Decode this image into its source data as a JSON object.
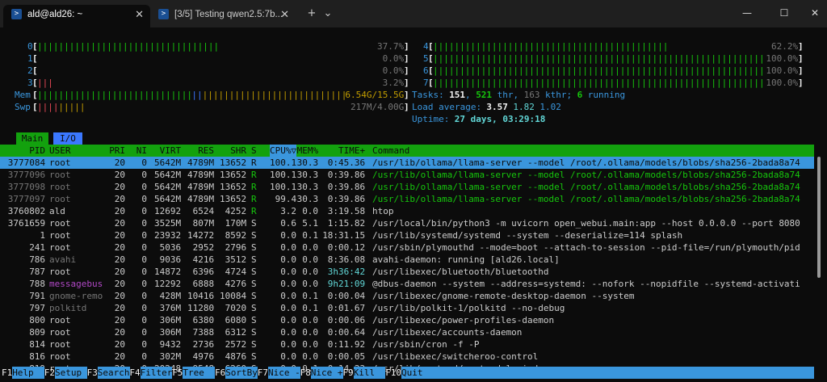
{
  "window": {
    "tabs": [
      {
        "title": "ald@ald26: ~",
        "icon": "terminal-icon"
      },
      {
        "title": "[3/5] Testing qwen2.5:7b...",
        "icon": "terminal-icon"
      }
    ],
    "controls": {
      "new_tab": "+",
      "dropdown": "⌄",
      "minimize": "—",
      "maximize": "☐",
      "close": "✕"
    }
  },
  "meters": {
    "cpus_left": [
      {
        "id": "0",
        "bar": "||||||||||||||||||||||||||||||||||",
        "pct": "37.7%"
      },
      {
        "id": "1",
        "bar": "",
        "pct": "0.0%"
      },
      {
        "id": "2",
        "bar": "",
        "pct": "0.0%"
      },
      {
        "id": "3",
        "bar": "|||",
        "pct": "3.2%"
      }
    ],
    "cpus_right": [
      {
        "id": "4",
        "bar": "|||||||||||||||||||||||||||||||||||||||||||||||||||||||||||||||||||||||||||",
        "pct": "62.2%"
      },
      {
        "id": "5",
        "bar": "||||||||||||||||||||||||||||||||||||||||||||||||||||||||||||||||||||||||||||||||||||||||||||||||||||||||||||||||||||||||||||",
        "pct": "100.0%"
      },
      {
        "id": "6",
        "bar": "||||||||||||||||||||||||||||||||||||||||||||||||||||||||||||||||||||||||||||||||||||||||||||||||||||||||||||||||||||||||||||",
        "pct": "100.0%"
      },
      {
        "id": "7",
        "bar": "||||||||||||||||||||||||||||||||||||||||||||||||||||||||||||||||||||||||||||||||||||||||||||||||||||||||||||||||||||||||||||",
        "pct": "100.0%"
      }
    ],
    "mem": {
      "label": "Mem",
      "used_bar": "|||||||||||||||||||||||||||||",
      "buffer_bar": "||",
      "cache_bar": "||||||||||||||||||||||||||||||||||||||||||||||||",
      "value": "6.54G/15.5G"
    },
    "swp": {
      "label": "Swp",
      "used_bar": "||||",
      "cache_bar": "|||||",
      "value": "217M/4.00G"
    },
    "tasks": {
      "label": "Tasks: ",
      "count": "151",
      "threads": "521",
      "thr_label": " thr, ",
      "kthr": "163",
      "kthr_label": " kthr; ",
      "running": "6",
      "running_label": " running"
    },
    "load": {
      "label": "Load average: ",
      "l1": "3.57",
      "l5": "1.82",
      "l15": "1.02"
    },
    "uptime": {
      "label": "Uptime: ",
      "value": "27 days, 03:29:18"
    }
  },
  "tabs": {
    "main": "Main",
    "io": "I/O"
  },
  "columns": {
    "pid": "PID",
    "user": "USER",
    "pri": "PRI",
    "ni": "NI",
    "virt": "VIRT",
    "res": "RES",
    "shr": "SHR",
    "s": "S",
    "cpu": "CPU%▽",
    "mem": "MEM%",
    "time": "TIME+",
    "cmd": "Command"
  },
  "processes": [
    {
      "pid": "3777084",
      "user": "root",
      "pri": "20",
      "ni": "0",
      "virt": "5642M",
      "res": "4789M",
      "shr": "13652",
      "s": "R",
      "cpu": "100.1",
      "mem": "30.3",
      "time": "0:45.36",
      "cmd": "/usr/lib/ollama/llama-server --model /root/.ollama/models/blobs/sha256-2bada8a74"
    },
    {
      "pid": "3777096",
      "user": "root",
      "pri": "20",
      "ni": "0",
      "virt": "5642M",
      "res": "4789M",
      "shr": "13652",
      "s": "R",
      "cpu": "100.1",
      "mem": "30.3",
      "time": "0:39.86",
      "cmd": "/usr/lib/ollama/llama-server --model /root/.ollama/models/blobs/sha256-2bada8a74"
    },
    {
      "pid": "3777098",
      "user": "root",
      "pri": "20",
      "ni": "0",
      "virt": "5642M",
      "res": "4789M",
      "shr": "13652",
      "s": "R",
      "cpu": "100.1",
      "mem": "30.3",
      "time": "0:39.86",
      "cmd": "/usr/lib/ollama/llama-server --model /root/.ollama/models/blobs/sha256-2bada8a74"
    },
    {
      "pid": "3777097",
      "user": "root",
      "pri": "20",
      "ni": "0",
      "virt": "5642M",
      "res": "4789M",
      "shr": "13652",
      "s": "R",
      "cpu": "99.4",
      "mem": "30.3",
      "time": "0:39.86",
      "cmd": "/usr/lib/ollama/llama-server --model /root/.ollama/models/blobs/sha256-2bada8a74"
    },
    {
      "pid": "3760802",
      "user": "ald",
      "pri": "20",
      "ni": "0",
      "virt": "12692",
      "res": "6524",
      "shr": "4252",
      "s": "R",
      "cpu": "3.2",
      "mem": "0.0",
      "time": "3:19.58",
      "cmd": "htop"
    },
    {
      "pid": "3761659",
      "user": "root",
      "pri": "20",
      "ni": "0",
      "virt": "3525M",
      "res": "807M",
      "shr": "170M",
      "s": "S",
      "cpu": "0.6",
      "mem": "5.1",
      "time": "1:15.82",
      "cmd": "/usr/local/bin/python3 -m uvicorn open_webui.main:app --host 0.0.0.0 --port 8080"
    },
    {
      "pid": "1",
      "user": "root",
      "pri": "20",
      "ni": "0",
      "virt": "23932",
      "res": "14272",
      "shr": "8592",
      "s": "S",
      "cpu": "0.0",
      "mem": "0.1",
      "time": "18:31.15",
      "cmd": "/usr/lib/systemd/systemd --system --deserialize=114 splash"
    },
    {
      "pid": "241",
      "user": "root",
      "pri": "20",
      "ni": "0",
      "virt": "5036",
      "res": "2952",
      "shr": "2796",
      "s": "S",
      "cpu": "0.0",
      "mem": "0.0",
      "time": "0:00.12",
      "cmd": "/usr/sbin/plymouthd --mode=boot --attach-to-session --pid-file=/run/plymouth/pid"
    },
    {
      "pid": "786",
      "user": "avahi",
      "pri": "20",
      "ni": "0",
      "virt": "9036",
      "res": "4216",
      "shr": "3512",
      "s": "S",
      "cpu": "0.0",
      "mem": "0.0",
      "time": "8:36.08",
      "cmd": "avahi-daemon: running [ald26.local]"
    },
    {
      "pid": "787",
      "user": "root",
      "pri": "20",
      "ni": "0",
      "virt": "14872",
      "res": "6396",
      "shr": "4724",
      "s": "S",
      "cpu": "0.0",
      "mem": "0.0",
      "time": "3h36:42",
      "cmd": "/usr/libexec/bluetooth/bluetoothd"
    },
    {
      "pid": "788",
      "user": "messagebus",
      "pri": "20",
      "ni": "0",
      "virt": "12292",
      "res": "6888",
      "shr": "4276",
      "s": "S",
      "cpu": "0.0",
      "mem": "0.0",
      "time": "9h21:09",
      "cmd": "@dbus-daemon --system --address=systemd: --nofork --nopidfile --systemd-activati"
    },
    {
      "pid": "791",
      "user": "gnome-remo",
      "pri": "20",
      "ni": "0",
      "virt": "428M",
      "res": "10416",
      "shr": "10084",
      "s": "S",
      "cpu": "0.0",
      "mem": "0.1",
      "time": "0:00.04",
      "cmd": "/usr/libexec/gnome-remote-desktop-daemon --system"
    },
    {
      "pid": "797",
      "user": "polkitd",
      "pri": "20",
      "ni": "0",
      "virt": "376M",
      "res": "11280",
      "shr": "7020",
      "s": "S",
      "cpu": "0.0",
      "mem": "0.1",
      "time": "0:01.67",
      "cmd": "/usr/lib/polkit-1/polkitd --no-debug"
    },
    {
      "pid": "800",
      "user": "root",
      "pri": "20",
      "ni": "0",
      "virt": "306M",
      "res": "6380",
      "shr": "6080",
      "s": "S",
      "cpu": "0.0",
      "mem": "0.0",
      "time": "0:00.06",
      "cmd": "/usr/libexec/power-profiles-daemon"
    },
    {
      "pid": "809",
      "user": "root",
      "pri": "20",
      "ni": "0",
      "virt": "306M",
      "res": "7388",
      "shr": "6312",
      "s": "S",
      "cpu": "0.0",
      "mem": "0.0",
      "time": "0:00.64",
      "cmd": "/usr/libexec/accounts-daemon"
    },
    {
      "pid": "814",
      "user": "root",
      "pri": "20",
      "ni": "0",
      "virt": "9432",
      "res": "2736",
      "shr": "2572",
      "s": "S",
      "cpu": "0.0",
      "mem": "0.0",
      "time": "0:11.92",
      "cmd": "/usr/sbin/cron -f -P"
    },
    {
      "pid": "816",
      "user": "root",
      "pri": "20",
      "ni": "0",
      "virt": "302M",
      "res": "4976",
      "shr": "4876",
      "s": "S",
      "cpu": "0.0",
      "mem": "0.0",
      "time": "0:00.05",
      "cmd": "/usr/libexec/switcheroo-control"
    },
    {
      "pid": "819",
      "user": "root",
      "pri": "20",
      "ni": "0",
      "virt": "20248",
      "res": "9548",
      "shr": "6260",
      "s": "S",
      "cpu": "0.0",
      "mem": "0.1",
      "time": "0:14.23",
      "cmd": "/usr/lib/systemd/systemd-logind"
    }
  ],
  "fkeys": [
    {
      "key": "F1",
      "label": "Help  "
    },
    {
      "key": "F2",
      "label": "Setup "
    },
    {
      "key": "F3",
      "label": "Search"
    },
    {
      "key": "F4",
      "label": "Filter"
    },
    {
      "key": "F5",
      "label": "Tree  "
    },
    {
      "key": "F6",
      "label": "SortBy"
    },
    {
      "key": "F7",
      "label": "Nice -"
    },
    {
      "key": "F8",
      "label": "Nice +"
    },
    {
      "key": "F9",
      "label": "Kill  "
    },
    {
      "key": "F10",
      "label": "Quit"
    }
  ],
  "colors": {
    "cyan": "#3a96dd",
    "green": "#13a10e",
    "bright_green": "#16c60c",
    "red": "#e74856",
    "yellow": "#c19c00",
    "blue": "#3b78ff",
    "magenta": "#b148c6",
    "background": "#0c0c0c"
  }
}
